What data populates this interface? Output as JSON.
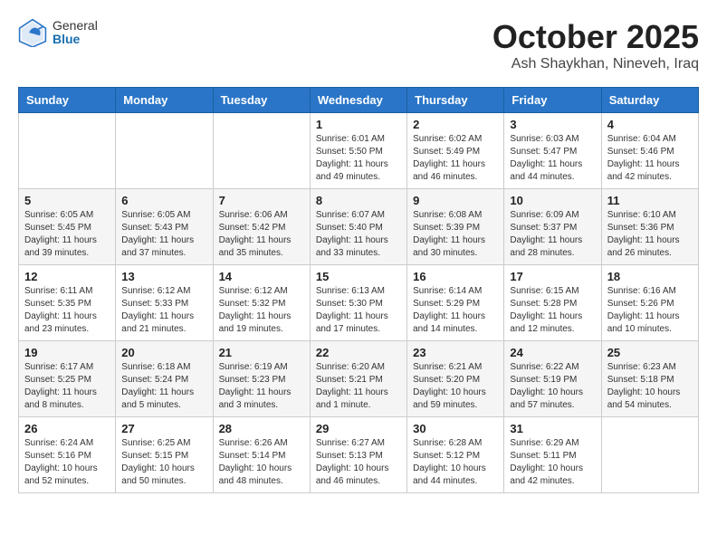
{
  "header": {
    "logo": {
      "general": "General",
      "blue": "Blue"
    },
    "title": "October 2025",
    "subtitle": "Ash Shaykhan, Nineveh, Iraq"
  },
  "calendar": {
    "headers": [
      "Sunday",
      "Monday",
      "Tuesday",
      "Wednesday",
      "Thursday",
      "Friday",
      "Saturday"
    ],
    "weeks": [
      [
        {
          "day": "",
          "info": ""
        },
        {
          "day": "",
          "info": ""
        },
        {
          "day": "",
          "info": ""
        },
        {
          "day": "1",
          "info": "Sunrise: 6:01 AM\nSunset: 5:50 PM\nDaylight: 11 hours and 49 minutes."
        },
        {
          "day": "2",
          "info": "Sunrise: 6:02 AM\nSunset: 5:49 PM\nDaylight: 11 hours and 46 minutes."
        },
        {
          "day": "3",
          "info": "Sunrise: 6:03 AM\nSunset: 5:47 PM\nDaylight: 11 hours and 44 minutes."
        },
        {
          "day": "4",
          "info": "Sunrise: 6:04 AM\nSunset: 5:46 PM\nDaylight: 11 hours and 42 minutes."
        }
      ],
      [
        {
          "day": "5",
          "info": "Sunrise: 6:05 AM\nSunset: 5:45 PM\nDaylight: 11 hours and 39 minutes."
        },
        {
          "day": "6",
          "info": "Sunrise: 6:05 AM\nSunset: 5:43 PM\nDaylight: 11 hours and 37 minutes."
        },
        {
          "day": "7",
          "info": "Sunrise: 6:06 AM\nSunset: 5:42 PM\nDaylight: 11 hours and 35 minutes."
        },
        {
          "day": "8",
          "info": "Sunrise: 6:07 AM\nSunset: 5:40 PM\nDaylight: 11 hours and 33 minutes."
        },
        {
          "day": "9",
          "info": "Sunrise: 6:08 AM\nSunset: 5:39 PM\nDaylight: 11 hours and 30 minutes."
        },
        {
          "day": "10",
          "info": "Sunrise: 6:09 AM\nSunset: 5:37 PM\nDaylight: 11 hours and 28 minutes."
        },
        {
          "day": "11",
          "info": "Sunrise: 6:10 AM\nSunset: 5:36 PM\nDaylight: 11 hours and 26 minutes."
        }
      ],
      [
        {
          "day": "12",
          "info": "Sunrise: 6:11 AM\nSunset: 5:35 PM\nDaylight: 11 hours and 23 minutes."
        },
        {
          "day": "13",
          "info": "Sunrise: 6:12 AM\nSunset: 5:33 PM\nDaylight: 11 hours and 21 minutes."
        },
        {
          "day": "14",
          "info": "Sunrise: 6:12 AM\nSunset: 5:32 PM\nDaylight: 11 hours and 19 minutes."
        },
        {
          "day": "15",
          "info": "Sunrise: 6:13 AM\nSunset: 5:30 PM\nDaylight: 11 hours and 17 minutes."
        },
        {
          "day": "16",
          "info": "Sunrise: 6:14 AM\nSunset: 5:29 PM\nDaylight: 11 hours and 14 minutes."
        },
        {
          "day": "17",
          "info": "Sunrise: 6:15 AM\nSunset: 5:28 PM\nDaylight: 11 hours and 12 minutes."
        },
        {
          "day": "18",
          "info": "Sunrise: 6:16 AM\nSunset: 5:26 PM\nDaylight: 11 hours and 10 minutes."
        }
      ],
      [
        {
          "day": "19",
          "info": "Sunrise: 6:17 AM\nSunset: 5:25 PM\nDaylight: 11 hours and 8 minutes."
        },
        {
          "day": "20",
          "info": "Sunrise: 6:18 AM\nSunset: 5:24 PM\nDaylight: 11 hours and 5 minutes."
        },
        {
          "day": "21",
          "info": "Sunrise: 6:19 AM\nSunset: 5:23 PM\nDaylight: 11 hours and 3 minutes."
        },
        {
          "day": "22",
          "info": "Sunrise: 6:20 AM\nSunset: 5:21 PM\nDaylight: 11 hours and 1 minute."
        },
        {
          "day": "23",
          "info": "Sunrise: 6:21 AM\nSunset: 5:20 PM\nDaylight: 10 hours and 59 minutes."
        },
        {
          "day": "24",
          "info": "Sunrise: 6:22 AM\nSunset: 5:19 PM\nDaylight: 10 hours and 57 minutes."
        },
        {
          "day": "25",
          "info": "Sunrise: 6:23 AM\nSunset: 5:18 PM\nDaylight: 10 hours and 54 minutes."
        }
      ],
      [
        {
          "day": "26",
          "info": "Sunrise: 6:24 AM\nSunset: 5:16 PM\nDaylight: 10 hours and 52 minutes."
        },
        {
          "day": "27",
          "info": "Sunrise: 6:25 AM\nSunset: 5:15 PM\nDaylight: 10 hours and 50 minutes."
        },
        {
          "day": "28",
          "info": "Sunrise: 6:26 AM\nSunset: 5:14 PM\nDaylight: 10 hours and 48 minutes."
        },
        {
          "day": "29",
          "info": "Sunrise: 6:27 AM\nSunset: 5:13 PM\nDaylight: 10 hours and 46 minutes."
        },
        {
          "day": "30",
          "info": "Sunrise: 6:28 AM\nSunset: 5:12 PM\nDaylight: 10 hours and 44 minutes."
        },
        {
          "day": "31",
          "info": "Sunrise: 6:29 AM\nSunset: 5:11 PM\nDaylight: 10 hours and 42 minutes."
        },
        {
          "day": "",
          "info": ""
        }
      ]
    ]
  }
}
